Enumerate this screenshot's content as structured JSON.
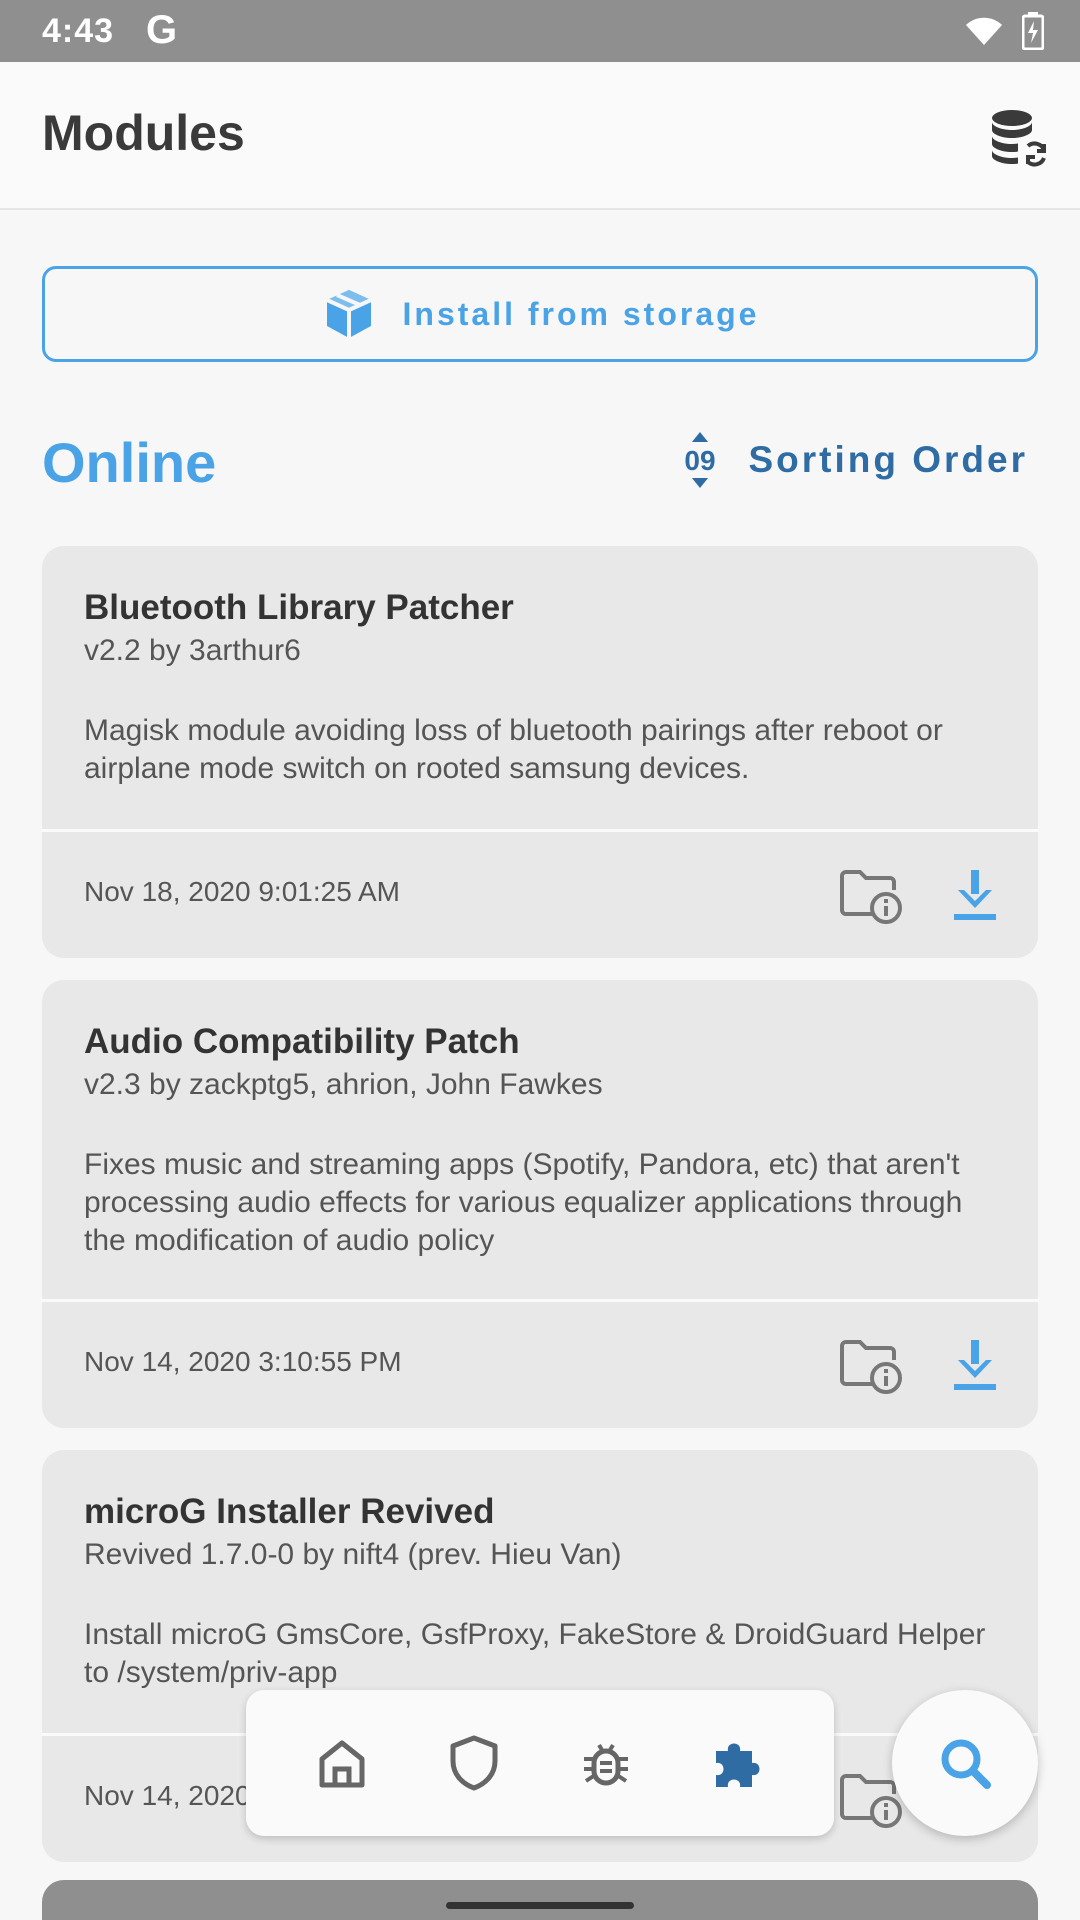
{
  "status_bar": {
    "time": "4:43",
    "g_logo": "G"
  },
  "app_bar": {
    "title": "Modules",
    "db_icon": "database-sync-icon"
  },
  "install": {
    "label": "Install from storage",
    "icon": "package-icon"
  },
  "section": {
    "title": "Online"
  },
  "sort": {
    "label": "Sorting Order",
    "icon_text": "09"
  },
  "modules": [
    {
      "title": "Bluetooth Library Patcher",
      "subtitle": "v2.2 by 3arthur6",
      "description": "Magisk module avoiding loss of bluetooth pairings after reboot or airplane mode switch on rooted samsung devices.",
      "date": "Nov 18, 2020 9:01:25 AM"
    },
    {
      "title": "Audio Compatibility Patch",
      "subtitle": "v2.3 by zackptg5, ahrion, John Fawkes",
      "description": "Fixes music and streaming apps (Spotify, Pandora, etc) that aren't processing audio effects for various equalizer applications through the modification of audio policy",
      "date": "Nov 14, 2020 3:10:55 PM"
    },
    {
      "title": "microG Installer Revived",
      "subtitle": "Revived 1.7.0-0 by nift4 (prev. Hieu Van)",
      "description": "Install microG GmsCore, GsfProxy, FakeStore & DroidGuard Helper to /system/priv-app",
      "date": "Nov 14, 2020"
    }
  ],
  "nav": [
    "home-icon",
    "shield-icon",
    "bug-icon",
    "puzzle-icon"
  ],
  "colors": {
    "accent": "#4aa3e6",
    "accent_dark": "#2e6ca3",
    "card": "#e8e8e8"
  }
}
